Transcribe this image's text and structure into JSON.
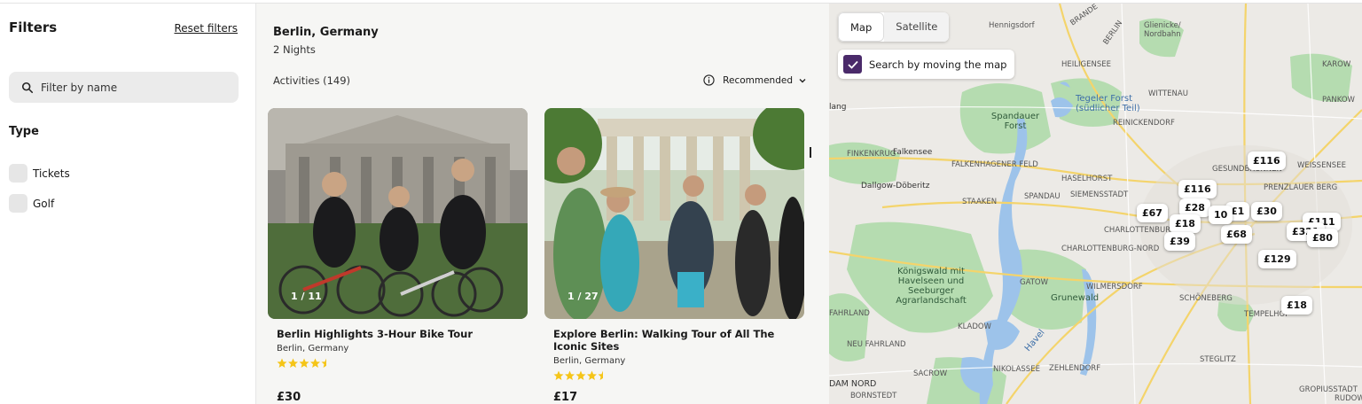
{
  "filters": {
    "title": "Filters",
    "reset_label": "Reset filters",
    "search_placeholder": "Filter by name",
    "type_heading": "Type",
    "types": [
      {
        "label": "Tickets",
        "checked": false
      },
      {
        "label": "Golf",
        "checked": false
      }
    ]
  },
  "results": {
    "destination": "Berlin, Germany",
    "nights": "2 Nights",
    "activities_count": "Activities (149)",
    "sort_label": "Recommended",
    "cards": [
      {
        "counter": "1 / 11",
        "title": "Berlin Highlights 3-Hour Bike Tour",
        "location": "Berlin, Germany",
        "rating": 4.5,
        "price": "£30"
      },
      {
        "counter": "1 / 27",
        "title": "Explore Berlin: Walking Tour of All The Iconic Sites",
        "location": "Berlin, Germany",
        "rating": 4.5,
        "price": "£17"
      }
    ]
  },
  "map": {
    "map_tab": "Map",
    "satellite_tab": "Satellite",
    "search_moving_label": "Search by moving the map",
    "search_moving_checked": true,
    "place_labels": {
      "hennigsdorf": "Hennigsdorf",
      "glienicke": "Glienicke/ Nordbahn",
      "heiligensee": "HEILIGENSEE",
      "karow": "KAROW",
      "wittenau": "WITTENAU",
      "tegeler_forst": "Tegeler Forst (südlicher Teil)",
      "spandauer_forst": "Spandauer Forst",
      "reinickendorf": "REINICKENDORF",
      "pankow": "PANKOW",
      "lang": "lang",
      "finkenkrug": "FINKENKRUG",
      "falkensee": "Falkensee",
      "falkenhagener_feld": "FALKENHAGENER FELD",
      "haselhorst": "HASELHORST",
      "gesundbrunnen": "GESUNDBRUNNEN",
      "weissensee": "WEISSENSEE",
      "dallgow": "Dallgow-Döberitz",
      "staaken": "STAAKEN",
      "spandau": "SPANDAU",
      "siemensstadt": "SIEMENSSTADT",
      "prenzlauer_berg": "PRENZLAUER BERG",
      "charlottenburg": "CHARLOTTENBURG",
      "charlottenburg_nord": "CHARLOTTENBURG-NORD",
      "koenigswald": "Königswald mit Havelseen und Seeburger Agrarlandschaft",
      "gatow": "GATOW",
      "grunewald": "Grunewald",
      "wilmersdorf": "WILMERSDORF",
      "schoeneberg": "SCHÖNEBERG",
      "fahrland": "FAHRLAND",
      "neu_fahrland": "NEU FAHRLAND",
      "kladow": "KLADOW",
      "tempelhof": "TEMPELHOF",
      "sacrow": "SACROW",
      "nikolassee": "NIKOLASSEE",
      "zehlendorf": "ZEHLENDORF",
      "steglitz": "STEGLITZ",
      "dam_nord": "DAM NORD",
      "bornstedt": "BORNSTEDT",
      "gropiusstadt": "GROPIUSSTADT",
      "rudow": "RUDOW",
      "havel": "Havel",
      "brande": "BRANDE",
      "berlin_road": "BERLIN"
    },
    "road_numbers": [
      "96",
      "114",
      "96a",
      "109",
      "5",
      "5",
      "2",
      "2",
      "1",
      "100",
      "115",
      "113",
      "96a",
      "96",
      "1",
      "96"
    ],
    "price_pins": [
      "£116",
      "£116",
      "£28",
      "£67",
      "£18",
      "£1",
      "£30",
      "£111",
      "£321",
      "£80",
      "£68",
      "£39",
      "£129",
      "£18",
      "10"
    ]
  },
  "colors": {
    "accent_checkbox": "#4a2a6a",
    "star_color": "#f5c518",
    "map_green": "#b5dcb0",
    "map_water": "#9dc3ea"
  }
}
